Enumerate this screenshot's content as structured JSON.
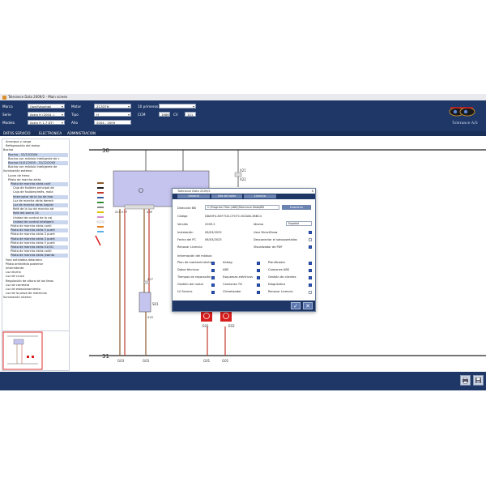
{
  "window": {
    "title": "Tolerance Data 2009/2 - Main screen"
  },
  "header": {
    "marca": {
      "label": "Marca",
      "value": "Opel/Vauxhall"
    },
    "serie": {
      "label": "Serie",
      "value": "Astra H (2004 -)"
    },
    "modelo": {
      "label": "Modelo",
      "value": "Astra H 1,7 DTI"
    },
    "motor": {
      "label": "Motor",
      "value": "Z17DTH"
    },
    "tipo": {
      "label": "Tipo",
      "value": "H"
    },
    "ano": {
      "label": "Año",
      "value": "2004 - 2009"
    },
    "primeros": {
      "label": "10 primeros",
      "value": ""
    },
    "ccm": {
      "label": "CCM",
      "value1": "1686",
      "cv_label": "CV",
      "value2": "101"
    },
    "logo_text": "Tolerance A/S"
  },
  "menu": {
    "items": [
      "DATOS SERVICIO",
      "ELECTRONICA",
      "ADMINISTRACION"
    ]
  },
  "tree": {
    "rows": [
      {
        "label": "Arranque y carga",
        "indent": 1,
        "state": ""
      },
      {
        "label": "Refrigeración del motor",
        "indent": 1,
        "state": ""
      },
      {
        "label": "Bocina",
        "indent": 0,
        "state": ""
      },
      {
        "label": "Bocina - 31/12/2004",
        "indent": 2,
        "state": "sel"
      },
      {
        "label": "Bocina con módulo inteligente de c",
        "indent": 2,
        "state": ""
      },
      {
        "label": "Bocina 01/01/2005 - 31/12/2005",
        "indent": 2,
        "state": "sel"
      },
      {
        "label": "Bocina con módulo inteligente de",
        "indent": 2,
        "state": ""
      },
      {
        "label": "Iluminación exterior",
        "indent": 0,
        "state": ""
      },
      {
        "label": "Luces de freno",
        "indent": 2,
        "state": ""
      },
      {
        "label": "Piloto de marcha atrás",
        "indent": 2,
        "state": ""
      },
      {
        "label": "Piloto de marcha atrás conf",
        "indent": 3,
        "state": "sel"
      },
      {
        "label": "Caja de fusibles principal de",
        "indent": 4,
        "state": ""
      },
      {
        "label": "Caja de fusibles/relés, mala",
        "indent": 4,
        "state": ""
      },
      {
        "label": "Interruptor de la luz de mar",
        "indent": 4,
        "state": "sel"
      },
      {
        "label": "Luz de marcha atrás derech",
        "indent": 4,
        "state": ""
      },
      {
        "label": "Luz de marcha atrás izquier",
        "indent": 4,
        "state": "sel"
      },
      {
        "label": "Relé de la luz de marcha atr",
        "indent": 4,
        "state": ""
      },
      {
        "label": "Relé del borne 15",
        "indent": 4,
        "state": "sel"
      },
      {
        "label": "Unidad de control de la caj",
        "indent": 4,
        "state": ""
      },
      {
        "label": "Unidad de control inteligent",
        "indent": 4,
        "state": "sel"
      },
      {
        "label": "Piloto de marcha atrás conti",
        "indent": 3,
        "state": ""
      },
      {
        "label": "Piloto de marcha atrás 5 puert",
        "indent": 3,
        "state": "sel"
      },
      {
        "label": "Piloto de marcha atrás 3 puert",
        "indent": 3,
        "state": ""
      },
      {
        "label": "Piloto de marcha atrás 3 puert",
        "indent": 3,
        "state": "sel"
      },
      {
        "label": "Piloto de marcha atrás 5 puert",
        "indent": 3,
        "state": ""
      },
      {
        "label": "Piloto de marcha atrás 01/01/",
        "indent": 3,
        "state": "sel"
      },
      {
        "label": "Piloto de marcha atrás conti",
        "indent": 3,
        "state": ""
      },
      {
        "label": "Piloto de marcha atrás (twinto",
        "indent": 3,
        "state": "sel"
      },
      {
        "label": "Faro antiniebla delantero",
        "indent": 1,
        "state": ""
      },
      {
        "label": "Piloto antiniebla posterior",
        "indent": 1,
        "state": ""
      },
      {
        "label": "Intermitente",
        "indent": 1,
        "state": ""
      },
      {
        "label": "Luz diurna",
        "indent": 1,
        "state": ""
      },
      {
        "label": "Luz de cruce",
        "indent": 1,
        "state": ""
      },
      {
        "label": "Regulación de altura de los faros",
        "indent": 1,
        "state": ""
      },
      {
        "label": "Luz de carretera",
        "indent": 1,
        "state": ""
      },
      {
        "label": "Luz de estacionamiento",
        "indent": 1,
        "state": ""
      },
      {
        "label": "Luz de la placa de matrícula",
        "indent": 1,
        "state": ""
      },
      {
        "label": "Iluminación interior",
        "indent": 0,
        "state": ""
      }
    ]
  },
  "diagram": {
    "rail_top": "30",
    "rail_bottom": "31",
    "labels": {
      "x62p": "X62P",
      "x21": "X21",
      "x22": "X22",
      "x5": "X5",
      "x10_01": "X10 01P",
      "x1": "X1",
      "x4p": "X4P",
      "x27": "X27",
      "x20": "X20",
      "s01": "S01",
      "e01": "E01",
      "e02": "E02",
      "g03a": "G03",
      "g03b": "G03",
      "g01a": "G01",
      "g01b": "G01"
    },
    "colors": {
      "wire_red": "#c0392b",
      "wire_brown": "#8b5a2b",
      "module": "#c4c4ee",
      "lamp": "#d81d1d"
    }
  },
  "dialog": {
    "title": "Tolerance Data 2009/2",
    "close": "x",
    "tabs": [
      "General",
      "Info del taller",
      "Licencia"
    ],
    "fields": {
      "dir_label": "Dirección BB",
      "dir_value": "C:\\Program Files (x86)\\Tolerance Data\\BB",
      "browse_label": "Examinar",
      "code_label": "Código",
      "code_value": "D8A9F4-D5F7CD-CFCFC-6CDAB-36BC4",
      "version_label": "Versión",
      "version_value": "2009.2",
      "idioma_label": "Idioma",
      "idioma_value": "Español",
      "install_label": "Instalación",
      "install_value": "06/03/2025",
      "pcdate_label": "Fecha del PC",
      "pcdate_value": "06/03/2025",
      "renew_label": "Renovar Licencia",
      "usar_label": "Usar DirectDraw",
      "desconectar_label": "Desconectar el salvapantallas",
      "visualizador_label": "Visualizador de PDF"
    },
    "checks": {
      "usar": true,
      "desconectar": false,
      "visualizador": true
    },
    "module_section": "Información del módulo",
    "modules": [
      {
        "label": "Plan de mantenimiento",
        "on": true
      },
      {
        "label": "Airbag",
        "on": true
      },
      {
        "label": "Planificador",
        "on": true
      },
      {
        "label": "Datos técnicos",
        "on": true
      },
      {
        "label": "ABS",
        "on": true
      },
      {
        "label": "Camiones ABS",
        "on": true
      },
      {
        "label": "Tiempos de reparación",
        "on": true
      },
      {
        "label": "Esquemas eléctricos",
        "on": true
      },
      {
        "label": "Gestión de clientes",
        "on": true
      },
      {
        "label": "Gestión del motor",
        "on": true
      },
      {
        "label": "Camiones TD",
        "on": true
      },
      {
        "label": "Diagnóstico",
        "on": true
      },
      {
        "label": "LV Service",
        "on": true
      },
      {
        "label": "Climatizador",
        "on": true
      },
      {
        "label": "Renovar Licencia",
        "on": false
      }
    ],
    "ok_label": "✓",
    "cancel_label": "✕"
  }
}
